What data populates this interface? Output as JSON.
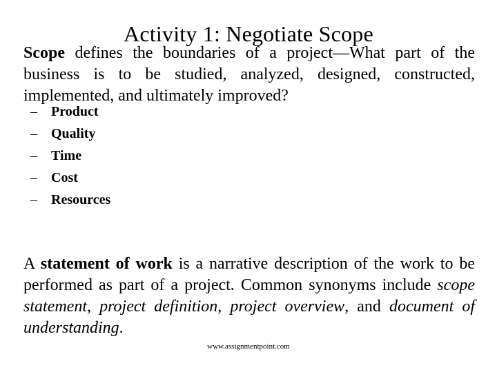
{
  "slide": {
    "title": "Activity 1: Negotiate Scope",
    "background_color": "#ffffff",
    "text_color": "#000000"
  },
  "intro_paragraph": {
    "lead_bold": "Scope",
    "rest": " defines the boundaries of a project—What part of the business is to be studied, analyzed, designed, constructed, implemented, and ultimately improved?"
  },
  "bullet_list": {
    "bullet_glyph": "–",
    "items": [
      {
        "label": "Product"
      },
      {
        "label": "Quality"
      },
      {
        "label": "Time"
      },
      {
        "label": "Cost"
      },
      {
        "label": "Resources"
      }
    ]
  },
  "closing_paragraph": {
    "seg1": "A ",
    "seg2_bold": "statement of work",
    "seg3": " is a narrative description of the work to be performed as part of a project. Common synonyms include ",
    "seg4_italic": "scope statement",
    "seg5": ", ",
    "seg6_italic": "project definition",
    "seg7": ", ",
    "seg8_italic": "project overview",
    "seg9": ", and ",
    "seg10_italic": "document of understanding",
    "seg11": "."
  },
  "footer": {
    "source": "www.assignmentpoint.com"
  }
}
